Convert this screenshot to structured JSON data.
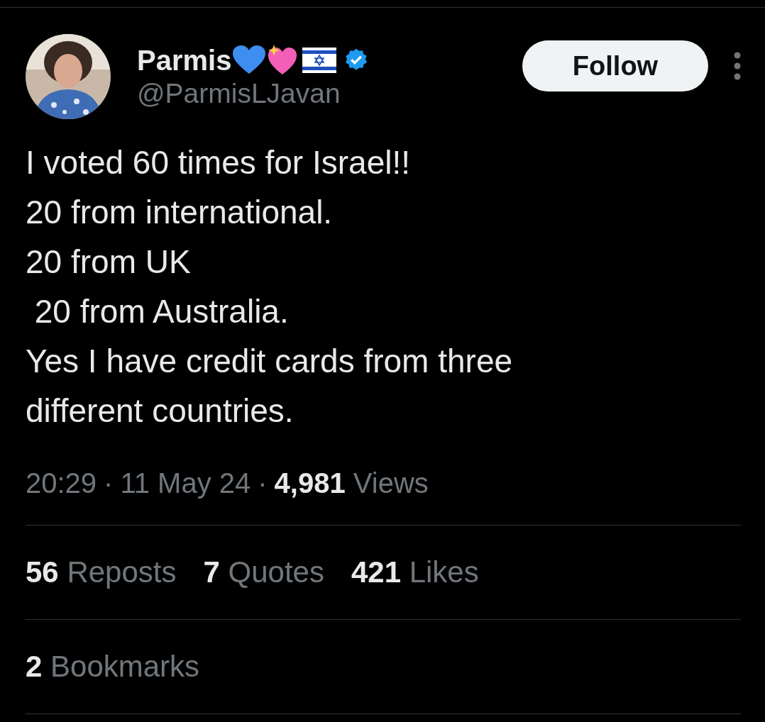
{
  "author": {
    "name": "Parmis",
    "handle": "@ParmisLJavan",
    "verified": true
  },
  "follow_button": {
    "label": "Follow"
  },
  "body": "I voted 60 times for Israel!!\n20 from international.\n20 from UK\n 20 from Australia.\nYes I have credit cards from three\ndifferent countries.",
  "meta": {
    "time": "20:29",
    "separator": "·",
    "date": "11 May 24",
    "views_count": "4,981",
    "views_label": "Views"
  },
  "stats": [
    {
      "count": "56",
      "label": "Reposts"
    },
    {
      "count": "7",
      "label": "Quotes"
    },
    {
      "count": "421",
      "label": "Likes"
    }
  ],
  "bookmarks": {
    "count": "2",
    "label": "Bookmarks"
  }
}
